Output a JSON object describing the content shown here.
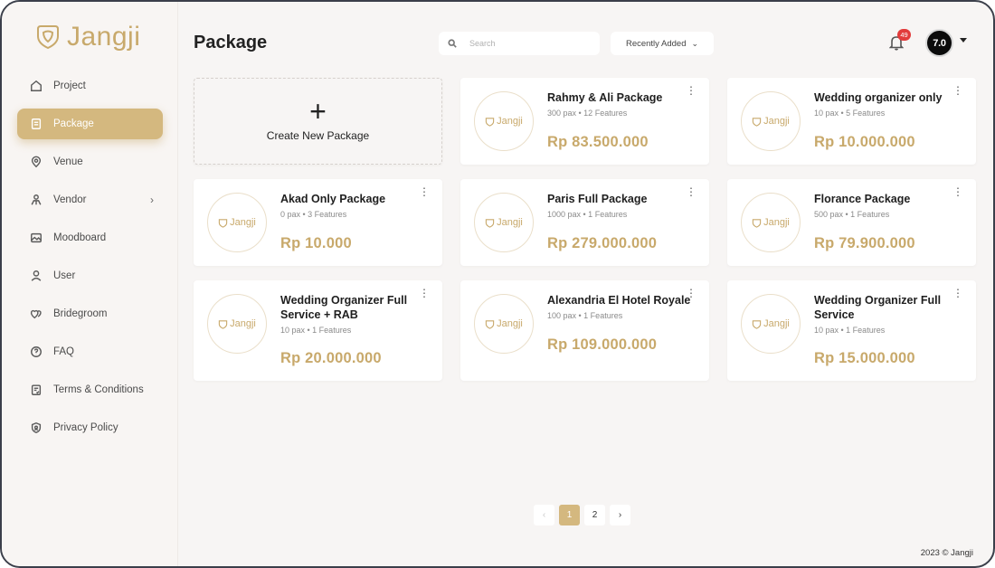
{
  "brand": {
    "name": "Jangji",
    "accent": "#c8a96b"
  },
  "sidebar": {
    "items": [
      {
        "label": "Project",
        "icon": "home-icon",
        "active": false
      },
      {
        "label": "Package",
        "icon": "document-icon",
        "active": true
      },
      {
        "label": "Venue",
        "icon": "location-pin-icon",
        "active": false
      },
      {
        "label": "Vendor",
        "icon": "vendor-icon",
        "active": false,
        "has_submenu": true
      },
      {
        "label": "Moodboard",
        "icon": "image-icon",
        "active": false
      },
      {
        "label": "User",
        "icon": "user-icon",
        "active": false
      },
      {
        "label": "Bridegroom",
        "icon": "hearts-icon",
        "active": false
      },
      {
        "label": "FAQ",
        "icon": "question-circle-icon",
        "active": false
      },
      {
        "label": "Terms & Conditions",
        "icon": "clipboard-icon",
        "active": false
      },
      {
        "label": "Privacy Policy",
        "icon": "shield-icon",
        "active": false
      }
    ]
  },
  "header": {
    "title": "Package",
    "search_placeholder": "Search",
    "sort_label": "Recently Added",
    "notification_count": "49",
    "avatar_text": "7.0"
  },
  "create_card": {
    "label": "Create New Package"
  },
  "packages": [
    {
      "name": "Rahmy & Ali Package",
      "meta": "300 pax • 12 Features",
      "price": "Rp 83.500.000",
      "thumb": "Jangji"
    },
    {
      "name": "Wedding organizer only",
      "meta": "10 pax • 5 Features",
      "price": "Rp 10.000.000",
      "thumb": "Jangji"
    },
    {
      "name": "Akad Only Package",
      "meta": "0 pax • 3 Features",
      "price": "Rp 10.000",
      "thumb": "Jangji"
    },
    {
      "name": "Paris Full Package",
      "meta": "1000 pax • 1 Features",
      "price": "Rp 279.000.000",
      "thumb": "Jangji"
    },
    {
      "name": "Florance Package",
      "meta": "500 pax • 1 Features",
      "price": "Rp 79.900.000",
      "thumb": "Jangji"
    },
    {
      "name": "Wedding Organizer Full Service + RAB",
      "meta": "10 pax • 1 Features",
      "price": "Rp 20.000.000",
      "thumb": "Jangji"
    },
    {
      "name": "Alexandria El Hotel Royale",
      "meta": "100 pax • 1 Features",
      "price": "Rp 109.000.000",
      "thumb": "Jangji"
    },
    {
      "name": "Wedding Organizer Full Service",
      "meta": "10 pax • 1 Features",
      "price": "Rp 15.000.000",
      "thumb": "Jangji"
    }
  ],
  "pagination": {
    "prev": "‹",
    "pages": [
      "1",
      "2"
    ],
    "current": "1",
    "next": "›"
  },
  "footer": {
    "text": "2023 © Jangji"
  }
}
